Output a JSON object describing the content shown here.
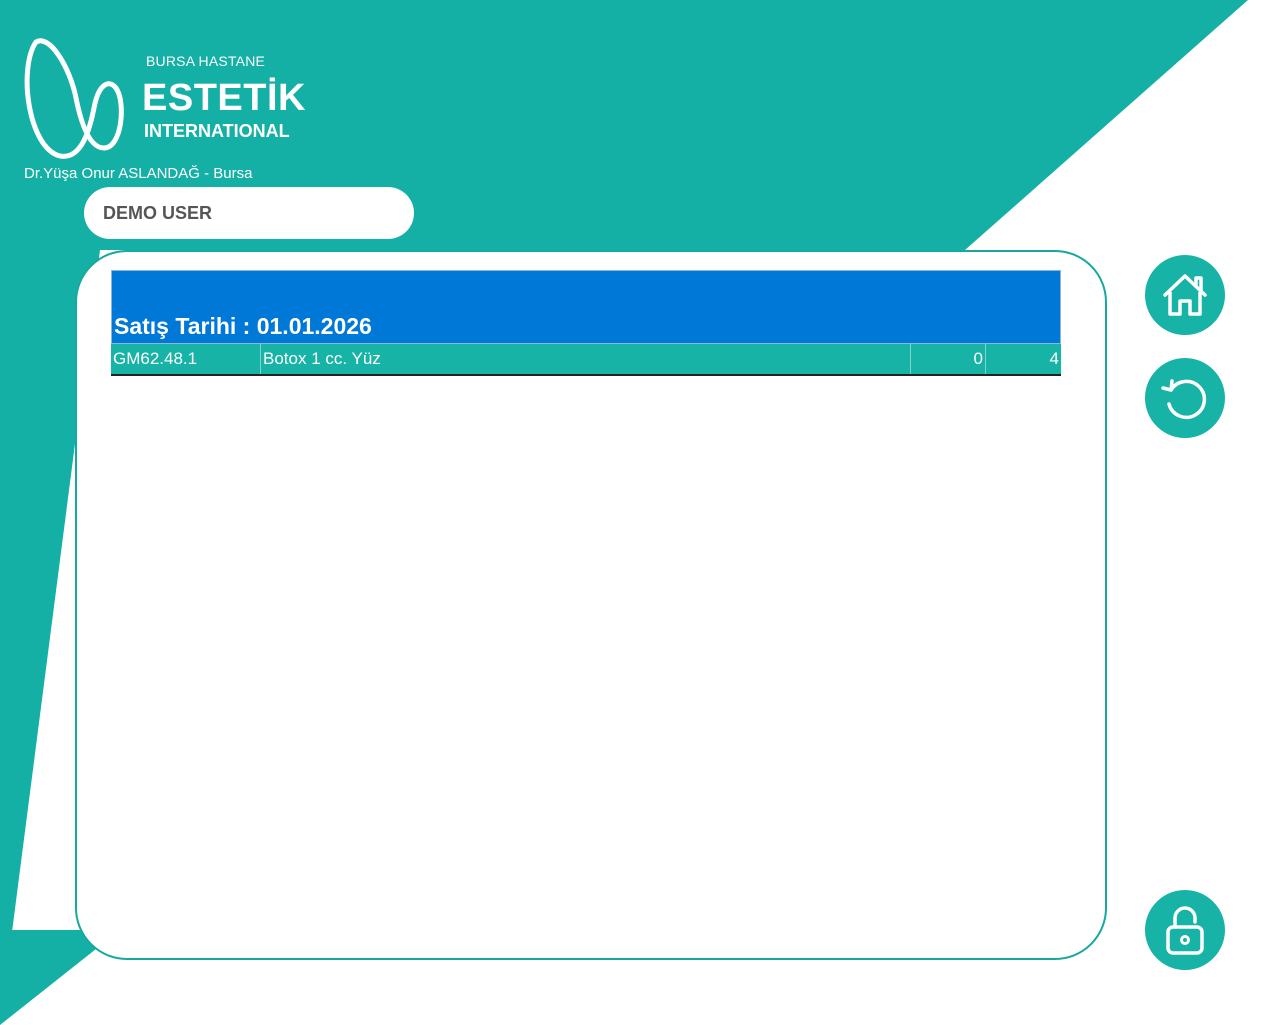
{
  "brand": {
    "top_line": "BURSA HASTANE",
    "name": "ESTETİK",
    "sub_line": "INTERNATIONAL",
    "logo_icon": "estetik-logo"
  },
  "doctor_line": "Dr.Yüşa Onur ASLANDAĞ - Bursa",
  "user": {
    "name": "DEMO USER"
  },
  "table": {
    "header_title": "Satış Tarihi : 01.01.2026",
    "rows": [
      {
        "code": "GM62.48.1",
        "description": "Botox 1 cc. Yüz",
        "value_a": "0",
        "value_b": "4"
      }
    ]
  },
  "side_buttons": [
    {
      "icon": "home-icon"
    },
    {
      "icon": "refresh-icon"
    },
    {
      "icon": "lock-icon"
    }
  ],
  "colors": {
    "teal": "#17b3a6",
    "header_blue": "#0078d7",
    "panel_border": "#17a99e",
    "user_text": "#555555"
  }
}
